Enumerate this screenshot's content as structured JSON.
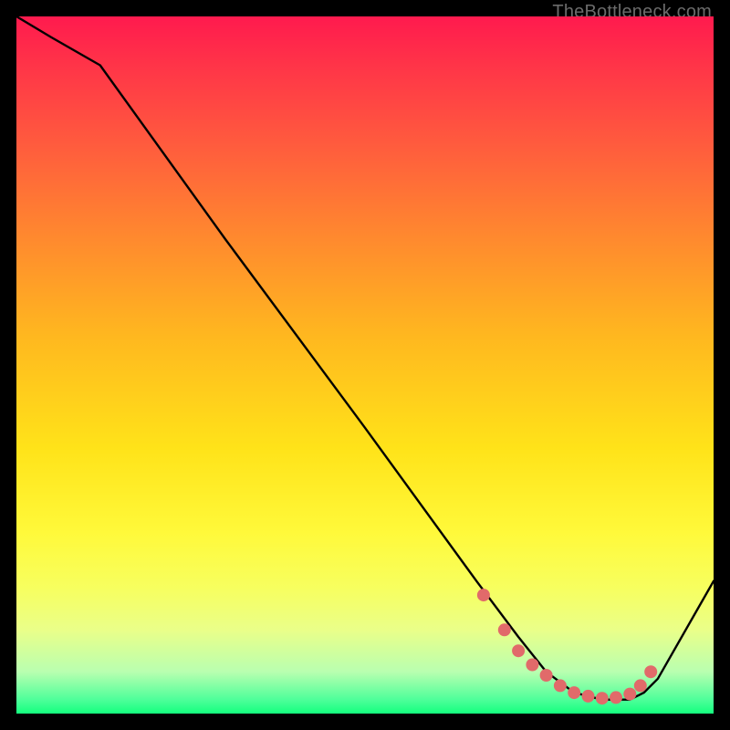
{
  "watermark": {
    "text": "TheBottleneck.com"
  },
  "chart_data": {
    "type": "line",
    "title": "",
    "xlabel": "",
    "ylabel": "",
    "xlim": [
      0,
      100
    ],
    "ylim": [
      0,
      100
    ],
    "grid": false,
    "legend": false,
    "series": [
      {
        "name": "curve",
        "x": [
          0,
          5,
          12,
          30,
          50,
          66,
          72,
          76,
          80,
          84,
          88,
          90,
          92,
          100
        ],
        "y": [
          100,
          97,
          93,
          68,
          41,
          19,
          11,
          6,
          3,
          2,
          2,
          3,
          5,
          19
        ]
      }
    ],
    "markers": {
      "name": "dots",
      "x": [
        67,
        70,
        72,
        74,
        76,
        78,
        80,
        82,
        84,
        86,
        88,
        89.5,
        91
      ],
      "y": [
        17,
        12,
        9,
        7,
        5.5,
        4,
        3,
        2.5,
        2.2,
        2.3,
        2.8,
        4,
        6
      ]
    },
    "colors": {
      "line": "#000000",
      "marker": "#e16a6a"
    }
  }
}
